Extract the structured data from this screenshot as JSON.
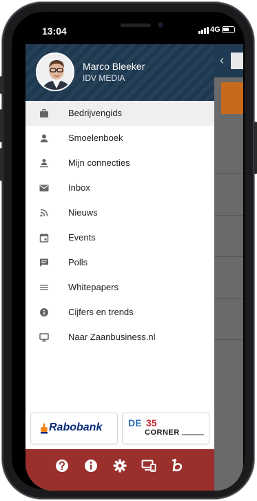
{
  "status_bar": {
    "time": "13:04",
    "network": "4G"
  },
  "profile": {
    "name": "Marco Bleeker",
    "company": "IDV MEDIA"
  },
  "menu": {
    "items": [
      {
        "label": "Bedrijvengids",
        "icon": "briefcase-icon",
        "active": true
      },
      {
        "label": "Smoelenboek",
        "icon": "person-icon"
      },
      {
        "label": "Mijn connecties",
        "icon": "connections-icon"
      },
      {
        "label": "Inbox",
        "icon": "mail-icon"
      },
      {
        "label": "Nieuws",
        "icon": "rss-icon"
      },
      {
        "label": "Events",
        "icon": "calendar-icon"
      },
      {
        "label": "Polls",
        "icon": "chat-icon"
      },
      {
        "label": "Whitepapers",
        "icon": "lines-icon"
      },
      {
        "label": "Cijfers en trends",
        "icon": "info-icon"
      },
      {
        "label": "Naar Zaanbusiness.nl",
        "icon": "monitor-icon"
      }
    ]
  },
  "sponsors": {
    "rabobank": "Rabobank",
    "corner_prefix": "DE",
    "corner_number": "35",
    "corner_name": "CORNER"
  },
  "bottom_bar": {
    "icons": [
      "help-icon",
      "info-icon",
      "gear-icon",
      "devices-icon",
      "brand-b-icon"
    ]
  },
  "colors": {
    "header_blue": "#1f3a52",
    "bottom_bar_red": "#9a2f2c",
    "active_row": "#efefef"
  }
}
